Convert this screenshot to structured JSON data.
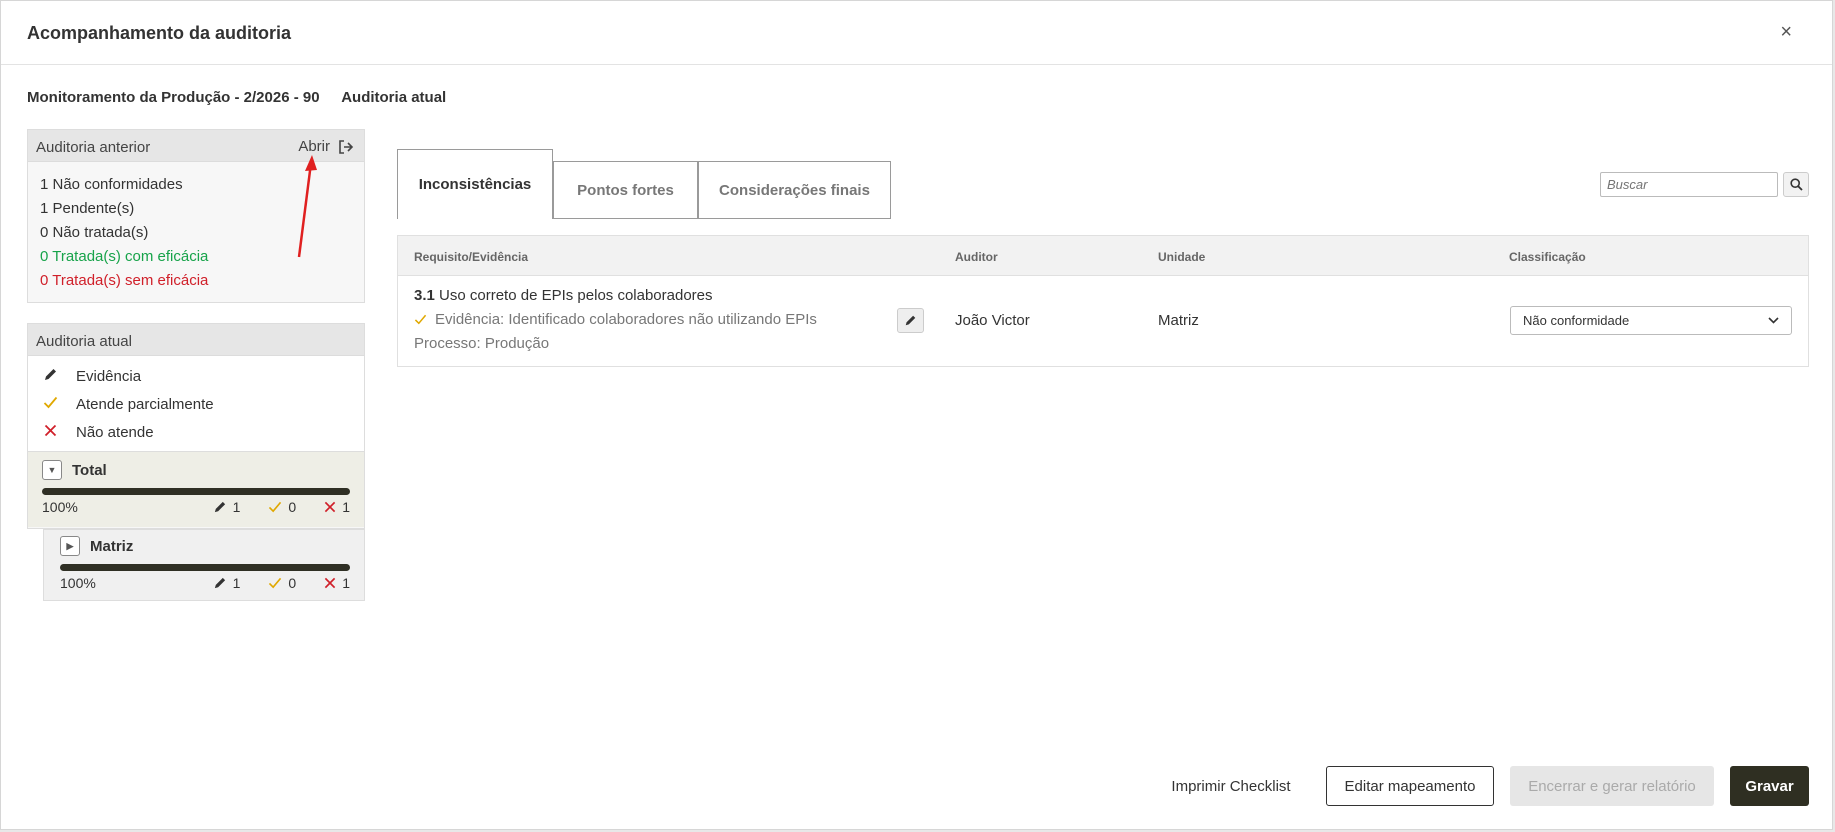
{
  "modal": {
    "title": "Acompanhamento da auditoria",
    "close": "×"
  },
  "subtitle": {
    "audit_name": "Monitoramento da Produção - 2/2026 - 90",
    "current_label": "Auditoria atual"
  },
  "previous_audit": {
    "title": "Auditoria anterior",
    "open_label": "Abrir",
    "stats": [
      "1 Não conformidades",
      "1 Pendente(s)",
      "0 Não tratada(s)",
      "0 Tratada(s) com eficácia",
      "0 Tratada(s) sem eficácia"
    ]
  },
  "current_audit": {
    "title": "Auditoria atual",
    "legend": [
      {
        "label": "Evidência",
        "icon": "pencil-icon"
      },
      {
        "label": "Atende parcialmente",
        "icon": "check-icon"
      },
      {
        "label": "Não atende",
        "icon": "x-icon"
      }
    ],
    "total": {
      "label": "Total",
      "progress": 1.0,
      "pct": "100%",
      "evidence": "1",
      "partial": "0",
      "fail": "1"
    },
    "unit": {
      "label": "Matriz",
      "progress": 1.0,
      "pct": "100%",
      "evidence": "1",
      "partial": "0",
      "fail": "1"
    }
  },
  "tabs": [
    {
      "label": "Inconsistências",
      "active": true
    },
    {
      "label": "Pontos fortes",
      "active": false
    },
    {
      "label": "Considerações finais",
      "active": false
    }
  ],
  "search": {
    "placeholder": "Buscar"
  },
  "table": {
    "columns": {
      "req": "Requisito/Evidência",
      "auditor": "Auditor",
      "unit": "Unidade",
      "classification": "Classificação"
    },
    "rows": [
      {
        "code": "3.1",
        "title": "Uso correto de EPIs pelos colaboradores",
        "evidence": "Evidência: Identificado colaboradores não utilizando EPIs",
        "process": "Processo: Produção",
        "auditor": "João Victor",
        "unit": "Matriz",
        "classification": "Não conformidade"
      }
    ]
  },
  "footer": {
    "print": "Imprimir Checklist",
    "edit_mapping": "Editar mapeamento",
    "close_report": "Encerrar e gerar relatório",
    "save": "Gravar"
  },
  "colors": {
    "primary": "#2f2f22",
    "green": "#17a34a",
    "red": "#d0202a",
    "check": "#e0a800",
    "annotation_arrow": "#e02020"
  }
}
